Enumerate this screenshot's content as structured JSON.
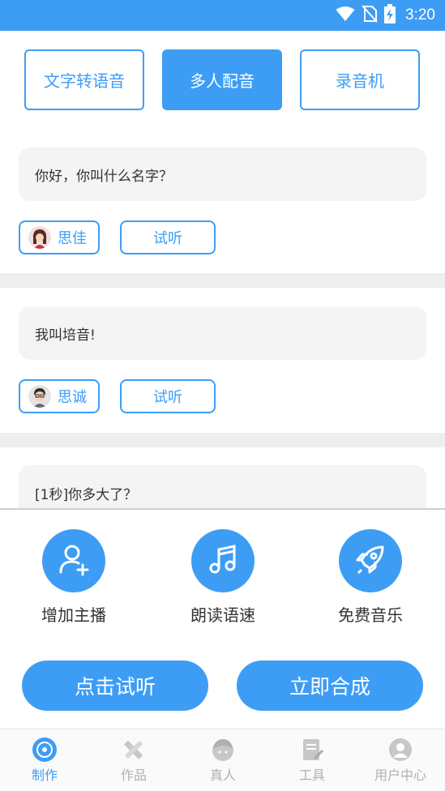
{
  "status_bar": {
    "time": "3:20"
  },
  "mode_tabs": [
    {
      "label": "文字转语音",
      "active": false
    },
    {
      "label": "多人配音",
      "active": true
    },
    {
      "label": "录音机",
      "active": false
    }
  ],
  "lines": [
    {
      "text": "你好，你叫什么名字？",
      "speaker": "思佳",
      "listen_label": "试听"
    },
    {
      "text": "我叫培音!",
      "speaker": "思诚",
      "listen_label": "试听"
    },
    {
      "text": "[1秒]你多大了？"
    }
  ],
  "actions": [
    {
      "label": "增加主播",
      "icon": "add-user-icon"
    },
    {
      "label": "朗读语速",
      "icon": "music-note-icon"
    },
    {
      "label": "免费音乐",
      "icon": "rocket-icon"
    }
  ],
  "buttons": {
    "listen": "点击试听",
    "synthesize": "立即合成"
  },
  "nav": [
    {
      "label": "制作",
      "icon": "disc-icon",
      "active": true
    },
    {
      "label": "作品",
      "icon": "pencil-ruler-icon",
      "active": false
    },
    {
      "label": "真人",
      "icon": "person-face-icon",
      "active": false
    },
    {
      "label": "工具",
      "icon": "document-tool-icon",
      "active": false
    },
    {
      "label": "用户中心",
      "icon": "user-icon",
      "active": false
    }
  ],
  "colors": {
    "accent": "#3d9df5",
    "bubble": "#f4f4f4",
    "divider": "#eeeeee"
  }
}
